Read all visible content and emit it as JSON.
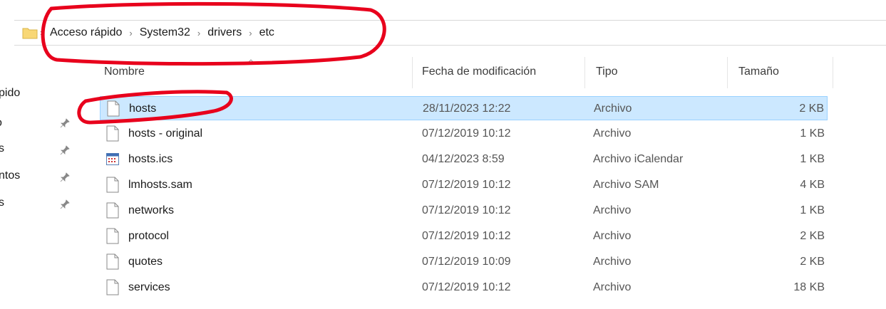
{
  "breadcrumb": [
    "Acceso rápido",
    "System32",
    "drivers",
    "etc"
  ],
  "columns": {
    "name": "Nombre",
    "date": "Fecha de modificación",
    "type": "Tipo",
    "size": "Tamaño"
  },
  "nav_items": [
    "pido",
    "o",
    "s",
    "ntos",
    "s"
  ],
  "files": [
    {
      "name": "hosts",
      "date": "28/11/2023 12:22",
      "type": "Archivo",
      "size": "2 KB",
      "icon": "file-icon",
      "selected": true
    },
    {
      "name": "hosts - original",
      "date": "07/12/2019 10:12",
      "type": "Archivo",
      "size": "1 KB",
      "icon": "file-icon"
    },
    {
      "name": "hosts.ics",
      "date": "04/12/2023 8:59",
      "type": "Archivo iCalendar",
      "size": "1 KB",
      "icon": "calendar-icon"
    },
    {
      "name": "lmhosts.sam",
      "date": "07/12/2019 10:12",
      "type": "Archivo SAM",
      "size": "4 KB",
      "icon": "file-icon"
    },
    {
      "name": "networks",
      "date": "07/12/2019 10:12",
      "type": "Archivo",
      "size": "1 KB",
      "icon": "file-icon"
    },
    {
      "name": "protocol",
      "date": "07/12/2019 10:12",
      "type": "Archivo",
      "size": "2 KB",
      "icon": "file-icon"
    },
    {
      "name": "quotes",
      "date": "07/12/2019 10:09",
      "type": "Archivo",
      "size": "2 KB",
      "icon": "file-icon"
    },
    {
      "name": "services",
      "date": "07/12/2019 10:12",
      "type": "Archivo",
      "size": "18 KB",
      "icon": "file-icon"
    }
  ],
  "colors": {
    "selection_bg": "#cce8ff",
    "selection_border": "#99d1ff",
    "annotation": "#e8001c",
    "folder": "#f8d775"
  }
}
